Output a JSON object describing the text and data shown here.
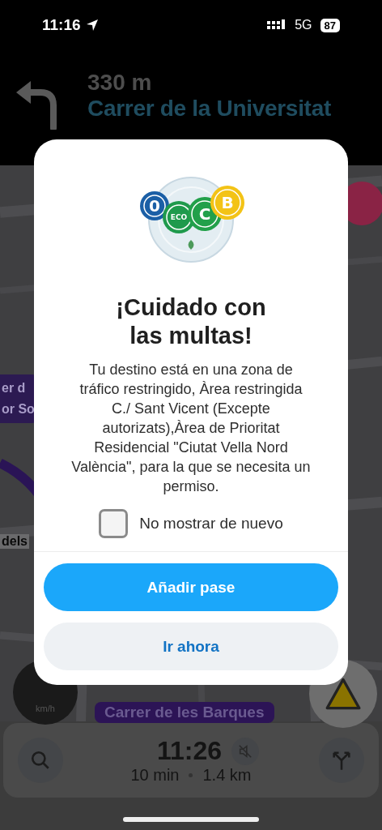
{
  "status_bar": {
    "time": "11:16",
    "network": "5G",
    "battery": "87"
  },
  "instruction": {
    "distance": "330 m",
    "street": "Carrer de la Universitat"
  },
  "map": {
    "street_tag": [
      "er d",
      "or So"
    ],
    "street_name": "dels",
    "route_pill": "Carrer de les Barques",
    "speed_unit": "km/h"
  },
  "dialog": {
    "badges": [
      {
        "label": "0",
        "color": "#1b5fa6"
      },
      {
        "label": "ECO",
        "color": "#1f9a4c"
      },
      {
        "label": "C",
        "color": "#22a04a"
      },
      {
        "label": "B",
        "color": "#f3c316"
      }
    ],
    "title": "¡Cuidado con las multas!",
    "body": "Tu destino está en una zona de tráfico restringido, Àrea restringida C./ Sant Vicent (Excepte autorizats),Àrea de Prioritat Residencial \"Ciutat Vella Nord València\", para la que se necesita un permiso.",
    "checkbox": {
      "label": "No mostrar de nuevo",
      "checked": false
    },
    "buttons": [
      {
        "label": "Añadir pase",
        "kind": "primary"
      },
      {
        "label": "Ir ahora",
        "kind": "secondary"
      }
    ]
  },
  "bottom_panel": {
    "eta": "11:26",
    "duration": "10 min",
    "distance": "1.4 km"
  }
}
